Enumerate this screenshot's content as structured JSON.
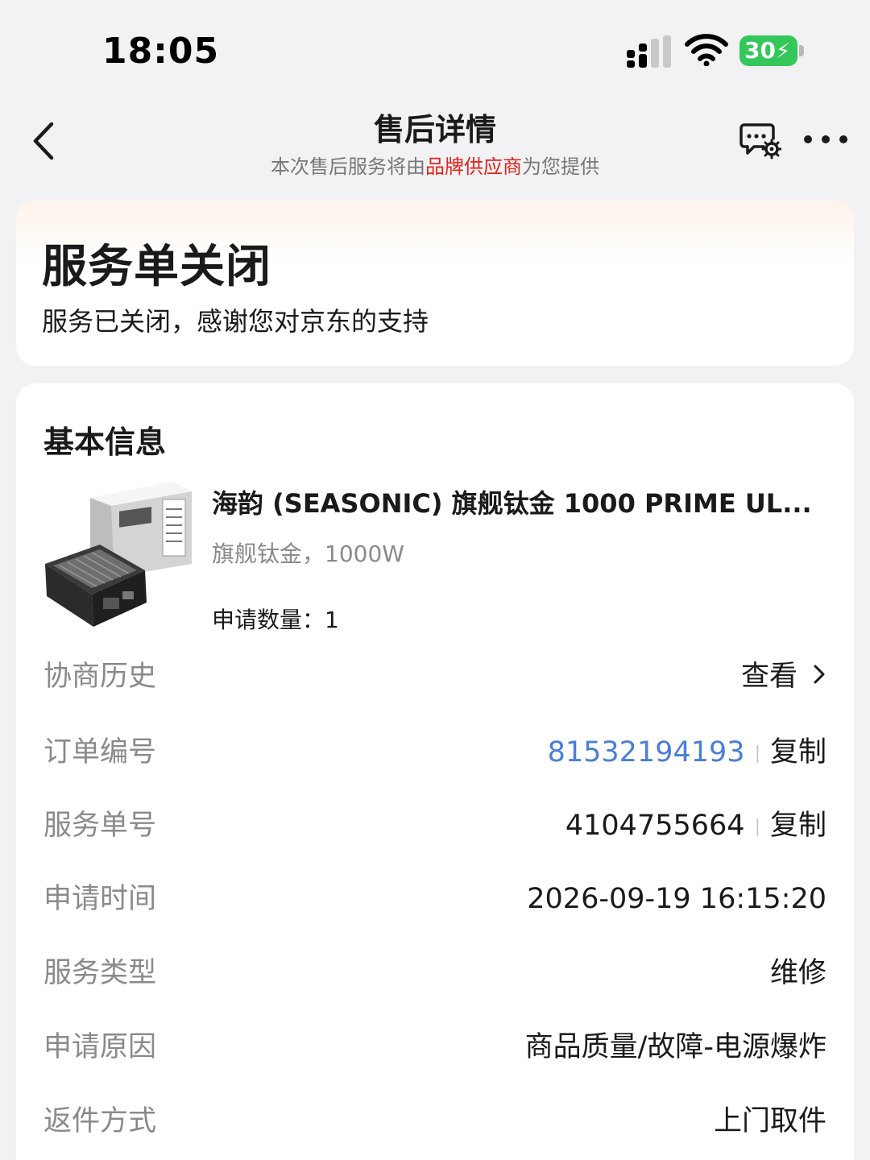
{
  "status_bar": {
    "time": "18:05",
    "battery": "30"
  },
  "nav": {
    "title": "售后详情",
    "subtitle_prefix": "本次售后服务将由",
    "subtitle_brand": "品牌供应商",
    "subtitle_suffix": "为您提供"
  },
  "status": {
    "title": "服务单关闭",
    "description": "服务已关闭，感谢您对京东的支持"
  },
  "basic_info": {
    "section_title": "基本信息",
    "product": {
      "name": "海韵 (SEASONIC) 旗舰钛金 1000 PRIME UL...",
      "spec": "旗舰钛金，1000W",
      "quantity_label": "申请数量：",
      "quantity": "1"
    },
    "rows": {
      "history": {
        "label": "协商历史",
        "value": "查看"
      },
      "order_number": {
        "label": "订单编号",
        "value": "81532194193",
        "action": "复制"
      },
      "service_number": {
        "label": "服务单号",
        "value": "4104755664",
        "action": "复制"
      },
      "apply_time": {
        "label": "申请时间",
        "value": "2026-09-19 16:15:20"
      },
      "service_type": {
        "label": "服务类型",
        "value": "维修"
      },
      "apply_reason": {
        "label": "申请原因",
        "value": "商品质量/故障-电源爆炸"
      },
      "return_method": {
        "label": "返件方式",
        "value": "上门取件"
      }
    }
  },
  "colors": {
    "brand_red": "#e2231a",
    "link_blue": "#4a7ed9",
    "battery_green": "#34c759"
  }
}
